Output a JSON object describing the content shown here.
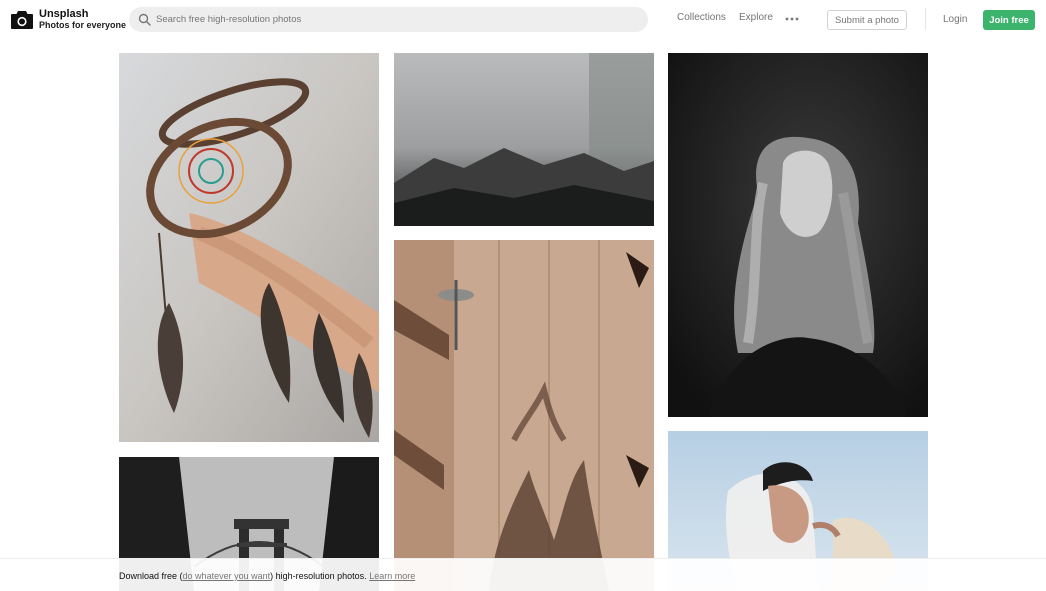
{
  "header": {
    "brand_name": "Unsplash",
    "brand_tagline": "Photos for everyone",
    "search_placeholder": "Search free high-resolution photos",
    "nav": [
      "Collections",
      "Explore"
    ],
    "submit_label": "Submit a photo",
    "login_label": "Login",
    "join_label": "Join free",
    "accent_color": "#3cb46e"
  },
  "icons": {
    "logo": "camera-icon",
    "search": "search-icon",
    "more": "more-dots-icon"
  },
  "photos": [
    {
      "subject": "dream catcher",
      "column": 1
    },
    {
      "subject": "misty mountains",
      "column": 2
    },
    {
      "subject": "woman portrait black and white",
      "column": 3
    },
    {
      "subject": "building with shadows",
      "column": 2
    },
    {
      "subject": "bridge between buildings",
      "column": 1
    },
    {
      "subject": "couple kissing",
      "column": 3
    }
  ],
  "banner": {
    "prefix": "Download free (",
    "link1": "do whatever you want",
    "middle": ") high-resolution photos.",
    "link2": "Learn more"
  }
}
